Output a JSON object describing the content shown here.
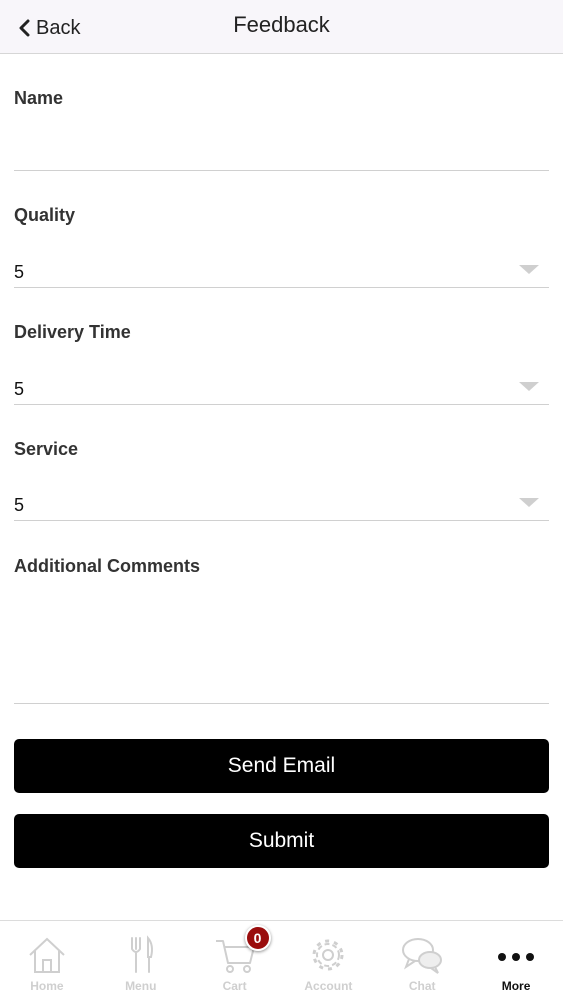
{
  "header": {
    "back_label": "Back",
    "title": "Feedback"
  },
  "form": {
    "name": {
      "label": "Name",
      "value": "",
      "placeholder": ""
    },
    "quality": {
      "label": "Quality",
      "value": "5"
    },
    "delivery_time": {
      "label": "Delivery Time",
      "value": "5"
    },
    "service": {
      "label": "Service",
      "value": "5"
    },
    "comments": {
      "label": "Additional Comments",
      "value": ""
    }
  },
  "buttons": {
    "send_email": "Send Email",
    "submit": "Submit"
  },
  "tab_bar": {
    "items": [
      {
        "label": "Home",
        "icon": "home-icon"
      },
      {
        "label": "Menu",
        "icon": "fork-knife-icon"
      },
      {
        "label": "Cart",
        "icon": "cart-icon",
        "badge": "0"
      },
      {
        "label": "Account",
        "icon": "gear-icon"
      },
      {
        "label": "Chat",
        "icon": "chat-bubbles-icon"
      },
      {
        "label": "More",
        "icon": "more-dots-icon",
        "active": true
      }
    ]
  },
  "colors": {
    "button_background": "#000000",
    "badge_background": "#9a0d0d",
    "inactive_tab": "#cfcfcf",
    "active_tab": "#111111"
  }
}
